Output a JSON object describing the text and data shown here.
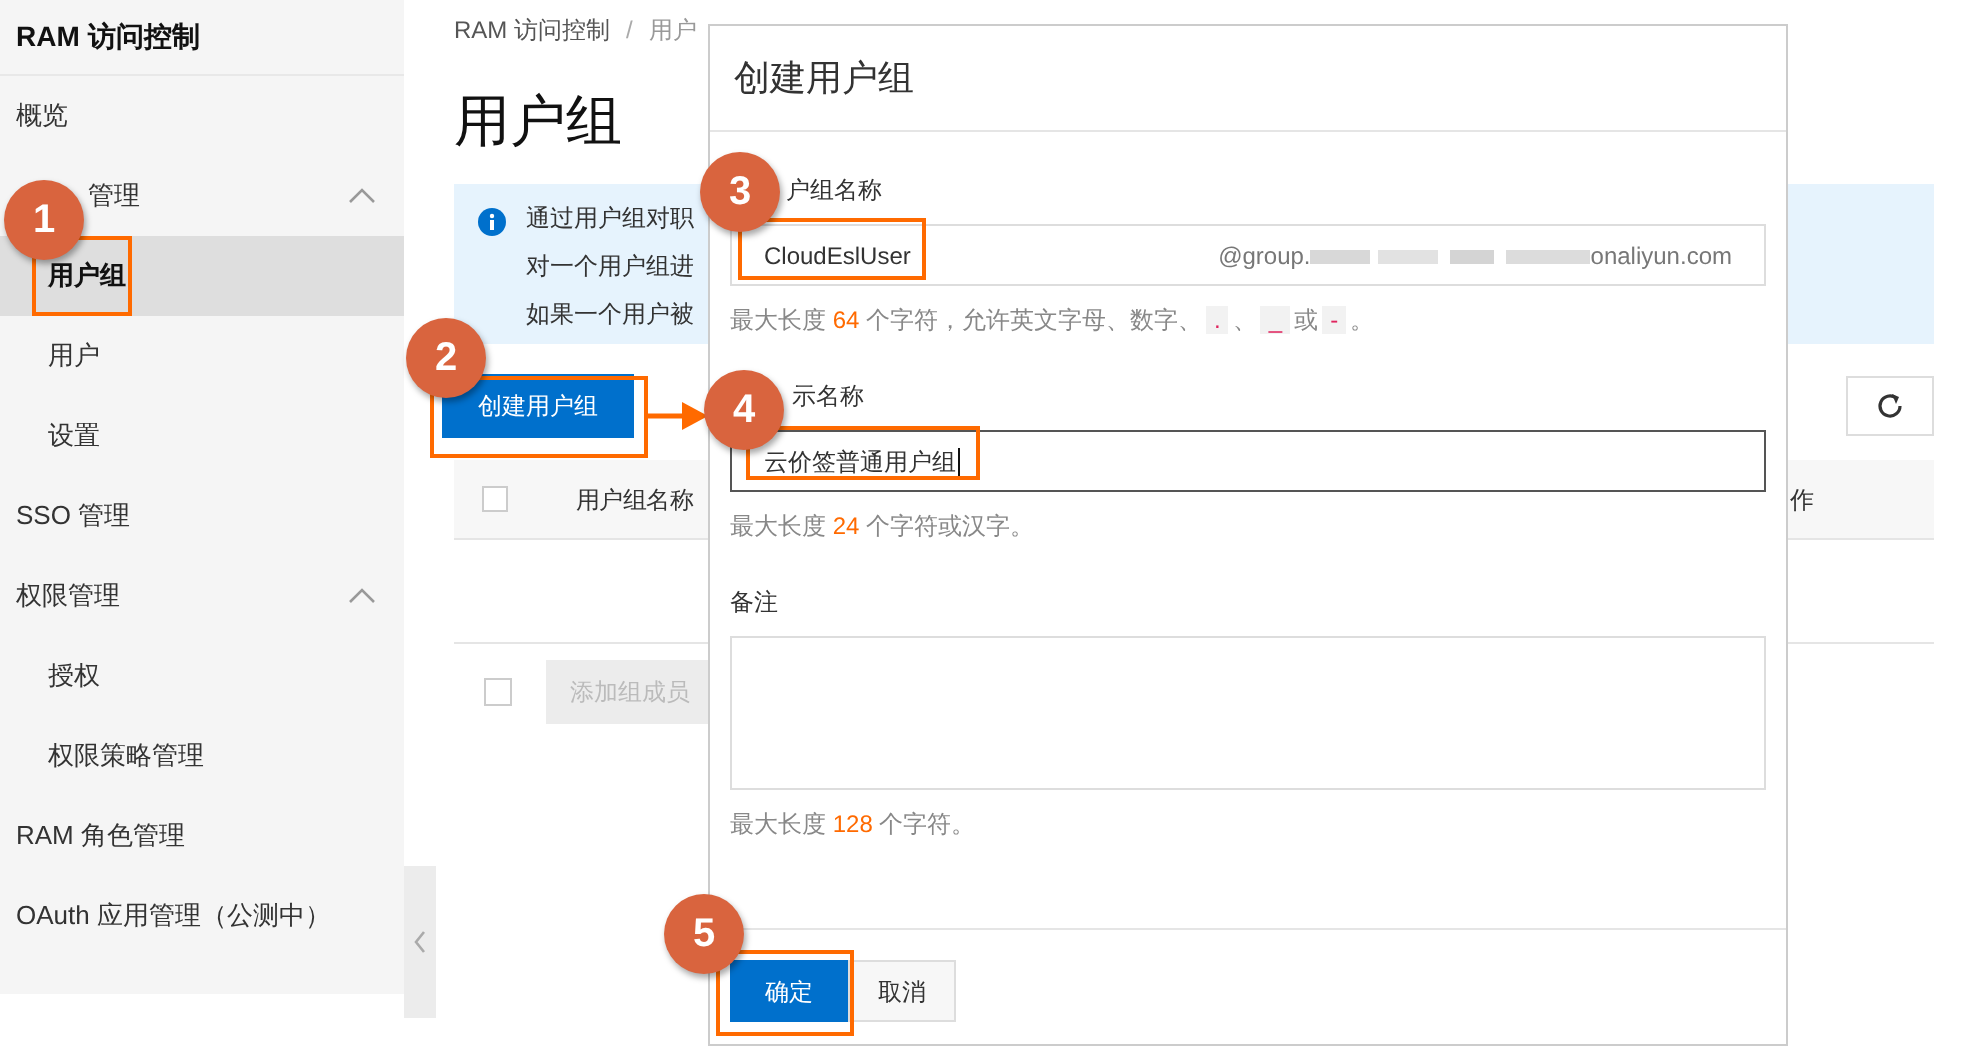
{
  "sidebar": {
    "title": "RAM 访问控制",
    "items": [
      {
        "label": "概览",
        "selected": false
      },
      {
        "label": "管理",
        "selected": false,
        "expanded": true,
        "children": [
          {
            "label": "用户组",
            "selected": true
          },
          {
            "label": "用户",
            "selected": false
          },
          {
            "label": "设置",
            "selected": false
          }
        ]
      },
      {
        "label": "SSO 管理",
        "selected": false
      },
      {
        "label": "权限管理",
        "selected": false,
        "expanded": true,
        "children": [
          {
            "label": "授权",
            "selected": false
          },
          {
            "label": "权限策略管理",
            "selected": false
          }
        ]
      },
      {
        "label": "RAM 角色管理",
        "selected": false
      },
      {
        "label": "OAuth 应用管理（公测中）",
        "selected": false
      }
    ]
  },
  "breadcrumb": {
    "items": [
      "RAM 访问控制",
      "用户"
    ],
    "separator": "/"
  },
  "page_title": "用户组",
  "info_lines": [
    "通过用户组对职",
    "对一个用户组进",
    "如果一个用户被"
  ],
  "create_button": "创建用户组",
  "table": {
    "select_all_checked": false,
    "columns": [
      "用户组名称",
      "作"
    ]
  },
  "footer_checkbox": {
    "checked": false
  },
  "add_member_button": {
    "label": "添加组成员",
    "disabled": true
  },
  "dialog": {
    "title": "创建用户组",
    "fields": [
      {
        "kind": "input",
        "label": "户组名称",
        "value": "CloudEslUser",
        "focused": false,
        "suffix": [
          "@group.",
          "onaliyun.com"
        ],
        "hint": [
          {
            "kind": "plain",
            "text": "最大长度 "
          },
          {
            "kind": "number",
            "text": "64"
          },
          {
            "kind": "plain",
            "text": " 个字符，允许英文字母、数字、"
          },
          {
            "kind": "code",
            "text": "."
          },
          {
            "kind": "plain",
            "text": "、"
          },
          {
            "kind": "code",
            "text": "_"
          },
          {
            "kind": "plain",
            "text": "或"
          },
          {
            "kind": "code",
            "text": "-"
          },
          {
            "kind": "plain",
            "text": "。"
          }
        ]
      },
      {
        "kind": "input",
        "label": "示名称",
        "value": "云价签普通用户组",
        "focused": true,
        "hint": [
          {
            "kind": "plain",
            "text": "最大长度 "
          },
          {
            "kind": "number",
            "text": "24"
          },
          {
            "kind": "plain",
            "text": " 个字符或汉字。"
          }
        ]
      },
      {
        "kind": "textarea",
        "label": "备注",
        "hint": [
          {
            "kind": "plain",
            "text": "最大长度 "
          },
          {
            "kind": "number",
            "text": "128"
          },
          {
            "kind": "plain",
            "text": " 个字符。"
          }
        ]
      }
    ],
    "buttons": [
      {
        "kind": "primary",
        "label": "确定"
      },
      {
        "kind": "secondary",
        "label": "取消"
      }
    ]
  },
  "step_markers": [
    "1",
    "2",
    "3",
    "4",
    "5"
  ]
}
